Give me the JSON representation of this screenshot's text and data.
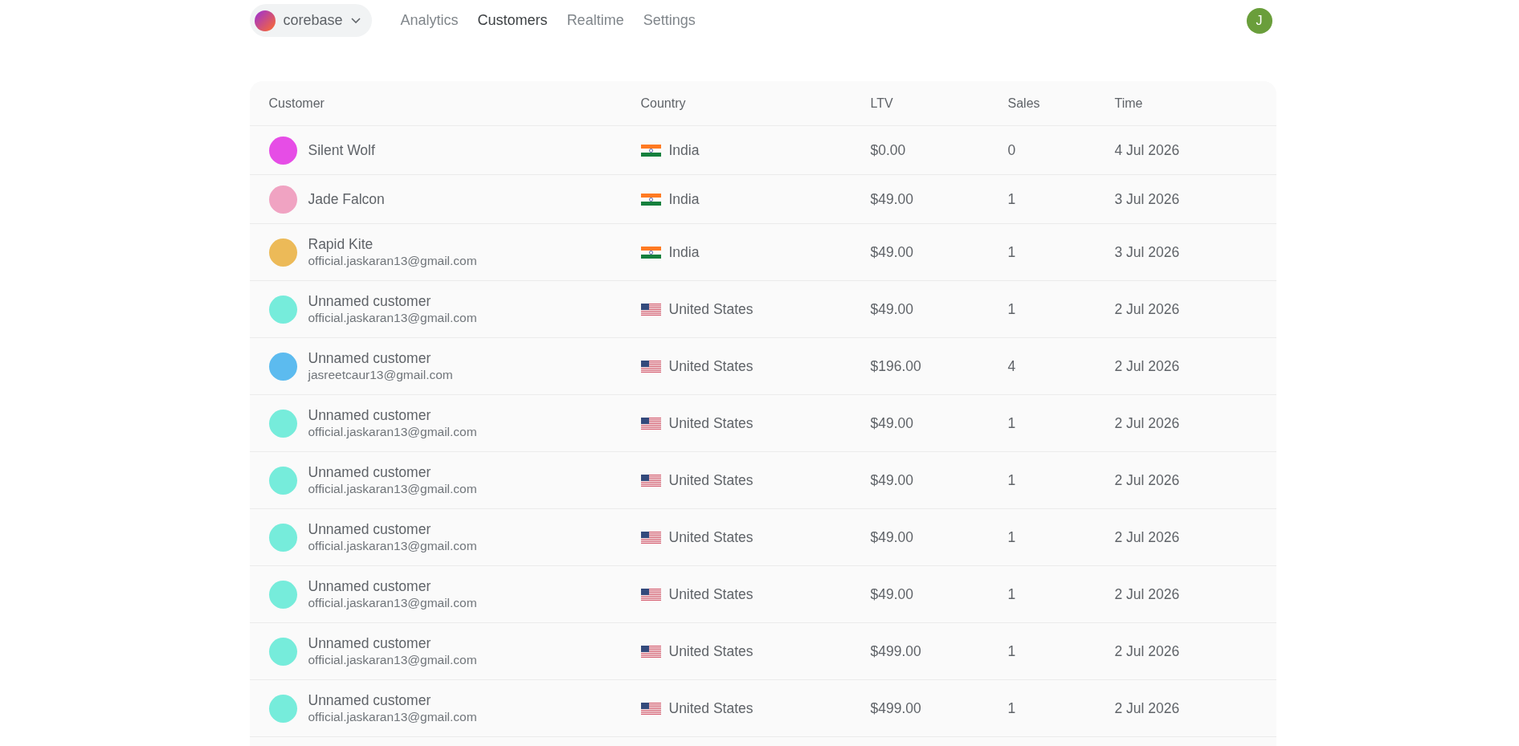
{
  "nav": {
    "workspace": {
      "name": "corebase"
    },
    "links": [
      {
        "label": "Analytics",
        "selected": false
      },
      {
        "label": "Customers",
        "selected": true
      },
      {
        "label": "Realtime",
        "selected": false
      },
      {
        "label": "Settings",
        "selected": false
      }
    ],
    "user": {
      "initial": "J"
    }
  },
  "table": {
    "columns": [
      "Customer",
      "Country",
      "LTV",
      "Sales",
      "Time"
    ],
    "rows": [
      {
        "customer": {
          "name": "Silent Wolf",
          "color": "#e64de6"
        },
        "country": {
          "name": "India",
          "kind": "india"
        },
        "ltv": "$0.00",
        "sales": "0",
        "time": "4 Jul 2026"
      },
      {
        "customer": {
          "name": "Jade Falcon",
          "color": "#f0a3c2"
        },
        "country": {
          "name": "India",
          "kind": "india"
        },
        "ltv": "$49.00",
        "sales": "1",
        "time": "3 Jul 2026"
      },
      {
        "customer": {
          "name": "Rapid Kite",
          "email": "official.jaskaran13@gmail.com",
          "color": "#ecba58"
        },
        "country": {
          "name": "India",
          "kind": "india"
        },
        "ltv": "$49.00",
        "sales": "1",
        "time": "3 Jul 2026"
      },
      {
        "customer": {
          "name": "Unnamed customer",
          "email": "official.jaskaran13@gmail.com",
          "color": "#76ecdb"
        },
        "country": {
          "name": "United States",
          "kind": "usa"
        },
        "ltv": "$49.00",
        "sales": "1",
        "time": "2 Jul 2026"
      },
      {
        "customer": {
          "name": "Unnamed customer",
          "email": "jasreetcaur13@gmail.com",
          "color": "#5cbbef"
        },
        "country": {
          "name": "United States",
          "kind": "usa"
        },
        "ltv": "$196.00",
        "sales": "4",
        "time": "2 Jul 2026"
      },
      {
        "customer": {
          "name": "Unnamed customer",
          "email": "official.jaskaran13@gmail.com",
          "color": "#76ecdb"
        },
        "country": {
          "name": "United States",
          "kind": "usa"
        },
        "ltv": "$49.00",
        "sales": "1",
        "time": "2 Jul 2026"
      },
      {
        "customer": {
          "name": "Unnamed customer",
          "email": "official.jaskaran13@gmail.com",
          "color": "#76ecdb"
        },
        "country": {
          "name": "United States",
          "kind": "usa"
        },
        "ltv": "$49.00",
        "sales": "1",
        "time": "2 Jul 2026"
      },
      {
        "customer": {
          "name": "Unnamed customer",
          "email": "official.jaskaran13@gmail.com",
          "color": "#76ecdb"
        },
        "country": {
          "name": "United States",
          "kind": "usa"
        },
        "ltv": "$49.00",
        "sales": "1",
        "time": "2 Jul 2026"
      },
      {
        "customer": {
          "name": "Unnamed customer",
          "email": "official.jaskaran13@gmail.com",
          "color": "#76ecdb"
        },
        "country": {
          "name": "United States",
          "kind": "usa"
        },
        "ltv": "$49.00",
        "sales": "1",
        "time": "2 Jul 2026"
      },
      {
        "customer": {
          "name": "Unnamed customer",
          "email": "official.jaskaran13@gmail.com",
          "color": "#76ecdb"
        },
        "country": {
          "name": "United States",
          "kind": "usa"
        },
        "ltv": "$499.00",
        "sales": "1",
        "time": "2 Jul 2026"
      },
      {
        "customer": {
          "name": "Unnamed customer",
          "email": "official.jaskaran13@gmail.com",
          "color": "#76ecdb"
        },
        "country": {
          "name": "United States",
          "kind": "usa"
        },
        "ltv": "$499.00",
        "sales": "1",
        "time": "2 Jul 2026"
      }
    ]
  }
}
